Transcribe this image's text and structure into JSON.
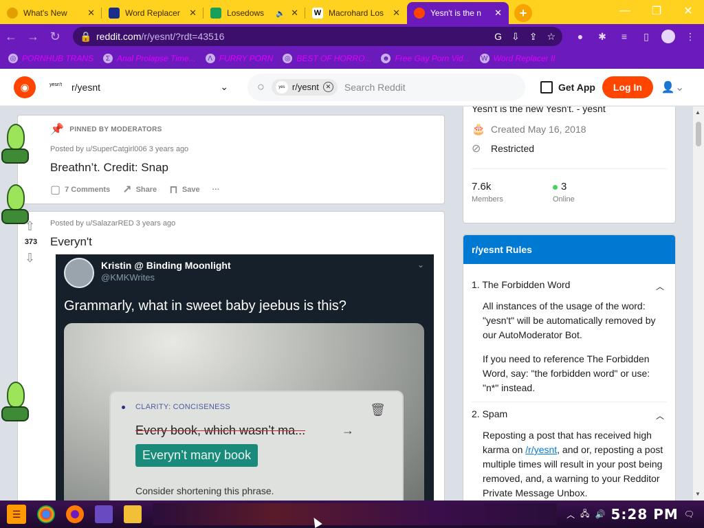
{
  "browser": {
    "tabs": [
      {
        "title": "What's New",
        "favicon_color": "#e1a000",
        "active": false
      },
      {
        "title": "Word Replacer",
        "favicon_color": "#1a2e8a",
        "active": false
      },
      {
        "title": "Losedows",
        "favicon_color": "#18a058",
        "active": false
      },
      {
        "title": "Macrohard Los",
        "favicon_color": "#ffffff",
        "active": false
      },
      {
        "title": "Yesn't is the n",
        "favicon_color": "#ff4500",
        "active": true
      }
    ],
    "new_tab": "+",
    "window_controls": {
      "minimize": "—",
      "restore": "❐",
      "close": "✕"
    },
    "url": {
      "host": "reddit.com",
      "path": "/r/yesnt/?rdt=43516"
    },
    "bookmarks": [
      {
        "label": "PORNHUB TRANS",
        "icon": "globe-icon"
      },
      {
        "label": "Anal Prolapse Time...",
        "icon": "bookmark-icon"
      },
      {
        "label": "FURRY PORN",
        "icon": "arrow-icon"
      },
      {
        "label": "BEST OF HORRO...",
        "icon": "globe-icon"
      },
      {
        "label": "Free Gay Porn Vid...",
        "icon": "bookmark-icon"
      },
      {
        "label": "Word Replacer II",
        "icon": "wr-icon"
      }
    ]
  },
  "reddit": {
    "header": {
      "community": "r/yesnt",
      "search_chip": "r/yesnt",
      "search_placeholder": "Search Reddit",
      "get_app": "Get App",
      "login": "Log In"
    },
    "posts": [
      {
        "pinned_label": "PINNED BY MODERATORS",
        "meta": "Posted by u/SuperCatgirl006 3 years ago",
        "title": "Breathn’t. Credit: Snap",
        "comments": "7 Comments",
        "share": "Share",
        "save": "Save",
        "more": "···"
      },
      {
        "votes": "373",
        "meta": "Posted by u/SalazarRED 3 years ago",
        "title": "Everyn't",
        "tweet": {
          "name": "Kristin @ Binding Moonlight",
          "handle": "@KMKWrites",
          "text": "Grammarly, what in sweet baby jeebus is this?",
          "card_label": "CLARITY: CONCISENESS",
          "original": "Every book, which wasn’t ma...",
          "suggestion": "Everyn’t many book",
          "hint": "Consider shortening this phrase."
        }
      }
    ],
    "sidebar": {
      "description": "Yesn't is the new Yesn't. - yesnt",
      "created": "Created May 16, 2018",
      "restricted": "Restricted",
      "members_value": "7.6k",
      "members_label": "Members",
      "online_value": "3",
      "online_label": "Online"
    },
    "rules": {
      "heading": "r/yesnt Rules",
      "items": [
        {
          "title": "1. The Forbidden Word",
          "body": "All instances of the usage of the word: \"yesn't\" will be automatically removed by our AutoModerator Bot.",
          "body2": "If you need to reference The Forbidden Word, say: \"the forbidden word\" or use: \"n*\" instead."
        },
        {
          "title": "2. Spam",
          "body_before": "Reposting a post that has received high karma on ",
          "body_link": "/r/yesnt",
          "body_after": ", and or, reposting a post multiple times will result in your post being removed, and, a warning to your Redditor Private Message Unbox."
        }
      ]
    }
  },
  "taskbar": {
    "start_label": "☰",
    "clock": "5:28 PM"
  }
}
